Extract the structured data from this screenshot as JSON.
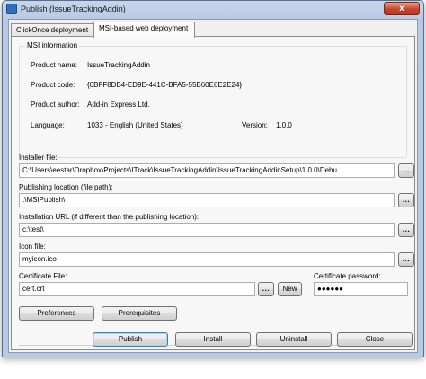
{
  "window": {
    "title": "Publish (IssueTrackingAddin)",
    "close_glyph": "x"
  },
  "tabs": [
    {
      "label": "ClickOnce deployment"
    },
    {
      "label": "MSI-based web deployment"
    }
  ],
  "msi_info": {
    "legend": "MSI information",
    "product_name_label": "Product name:",
    "product_name": "IssueTrackingAddin",
    "product_code_label": "Product code:",
    "product_code": "{0BFF8DB4-ED9E-441C-BFA5-55B60E6E2E24}",
    "product_author_label": "Product author:",
    "product_author": "Add-in Express Ltd.",
    "language_label": "Language:",
    "language": "1033 - English (United States)",
    "version_label": "Version:",
    "version": "1.0.0"
  },
  "installer": {
    "label": "Installer file:",
    "value": "C:\\Users\\eestar\\Dropbox\\Projects\\ITrack\\IssueTrackingAddin\\IssueTrackingAddinSetup\\1.0.0\\Debu"
  },
  "publishing": {
    "label": "Publishing location (file path):",
    "value": ".\\MSIPublish\\"
  },
  "installation_url": {
    "label": "Installation URL (if different than the publishing location):",
    "value": "c:\\test\\"
  },
  "icon": {
    "label": "Icon file:",
    "value": "myicon.ico"
  },
  "certificate": {
    "label": "Certificate File:",
    "value": "cert.crt",
    "new_label": "New",
    "password_label": "Certificate password:",
    "password_value": "●●●●●●"
  },
  "browse_label": "...",
  "buttons": {
    "preferences": "Preferences",
    "prerequisites": "Prerequisites",
    "publish": "Publish",
    "install": "Install",
    "uninstall": "Uninstall",
    "close": "Close"
  }
}
